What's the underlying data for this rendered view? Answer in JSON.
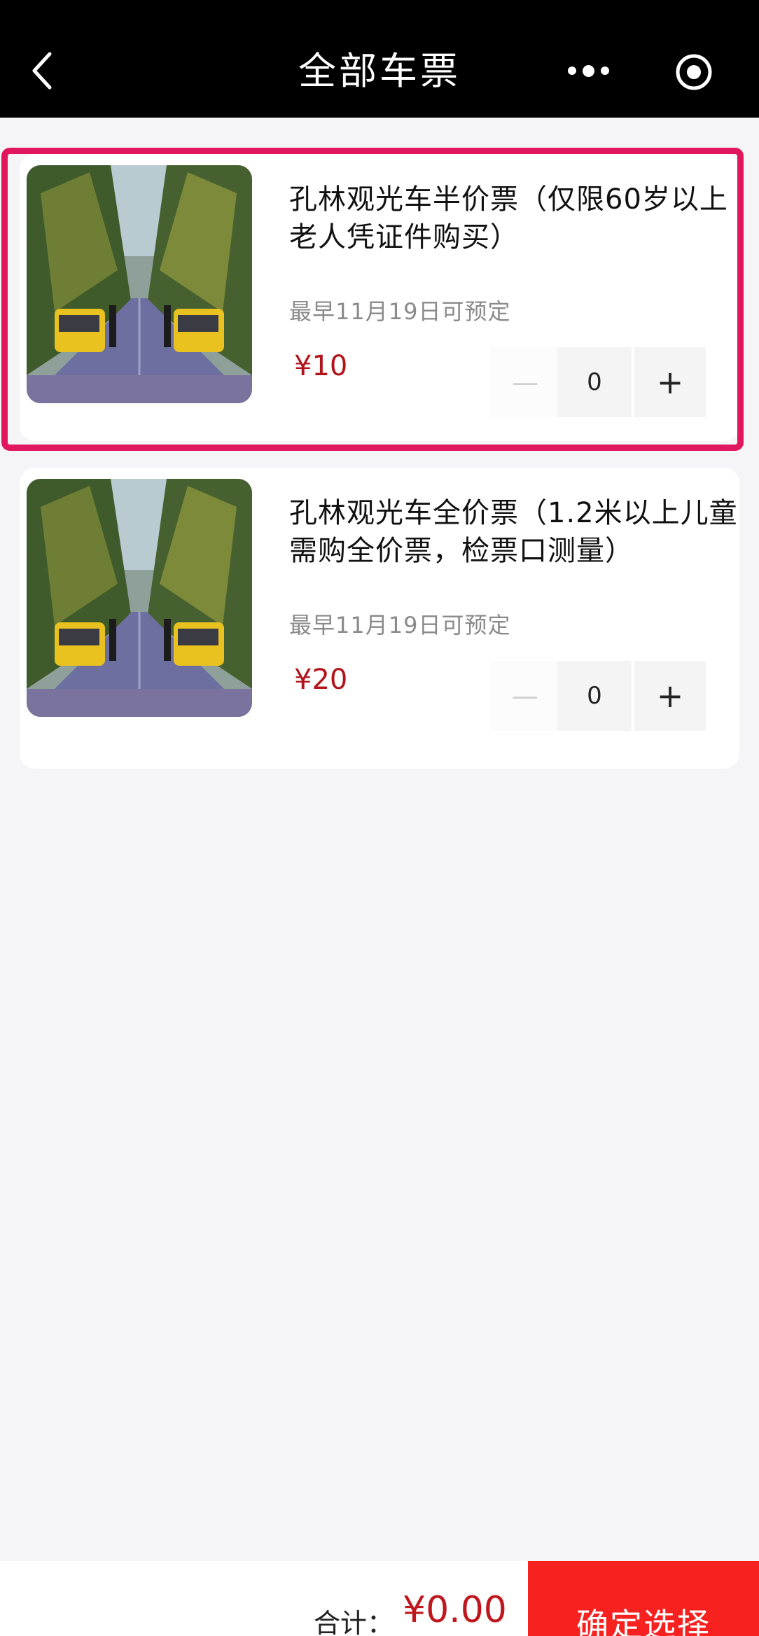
{
  "header": {
    "title": "全部车票"
  },
  "tickets": [
    {
      "title": "孔林观光车半价票（仅限60岁以上老人凭证件购买）",
      "date_note": "最早11月19日可预定",
      "price": "¥10",
      "quantity": "0"
    },
    {
      "title": "孔林观光车全价票（1.2米以上儿童需购全价票，检票口测量）",
      "date_note": "最早11月19日可预定",
      "price": "¥20",
      "quantity": "0"
    }
  ],
  "stepper": {
    "minus": "—",
    "plus": "+"
  },
  "footer": {
    "total_label": "合计：",
    "total_amount": "¥0.00",
    "confirm_label": "确定选择"
  },
  "colors": {
    "highlight": "#e0175f",
    "price": "#b3141c",
    "confirm": "#f7221f"
  }
}
